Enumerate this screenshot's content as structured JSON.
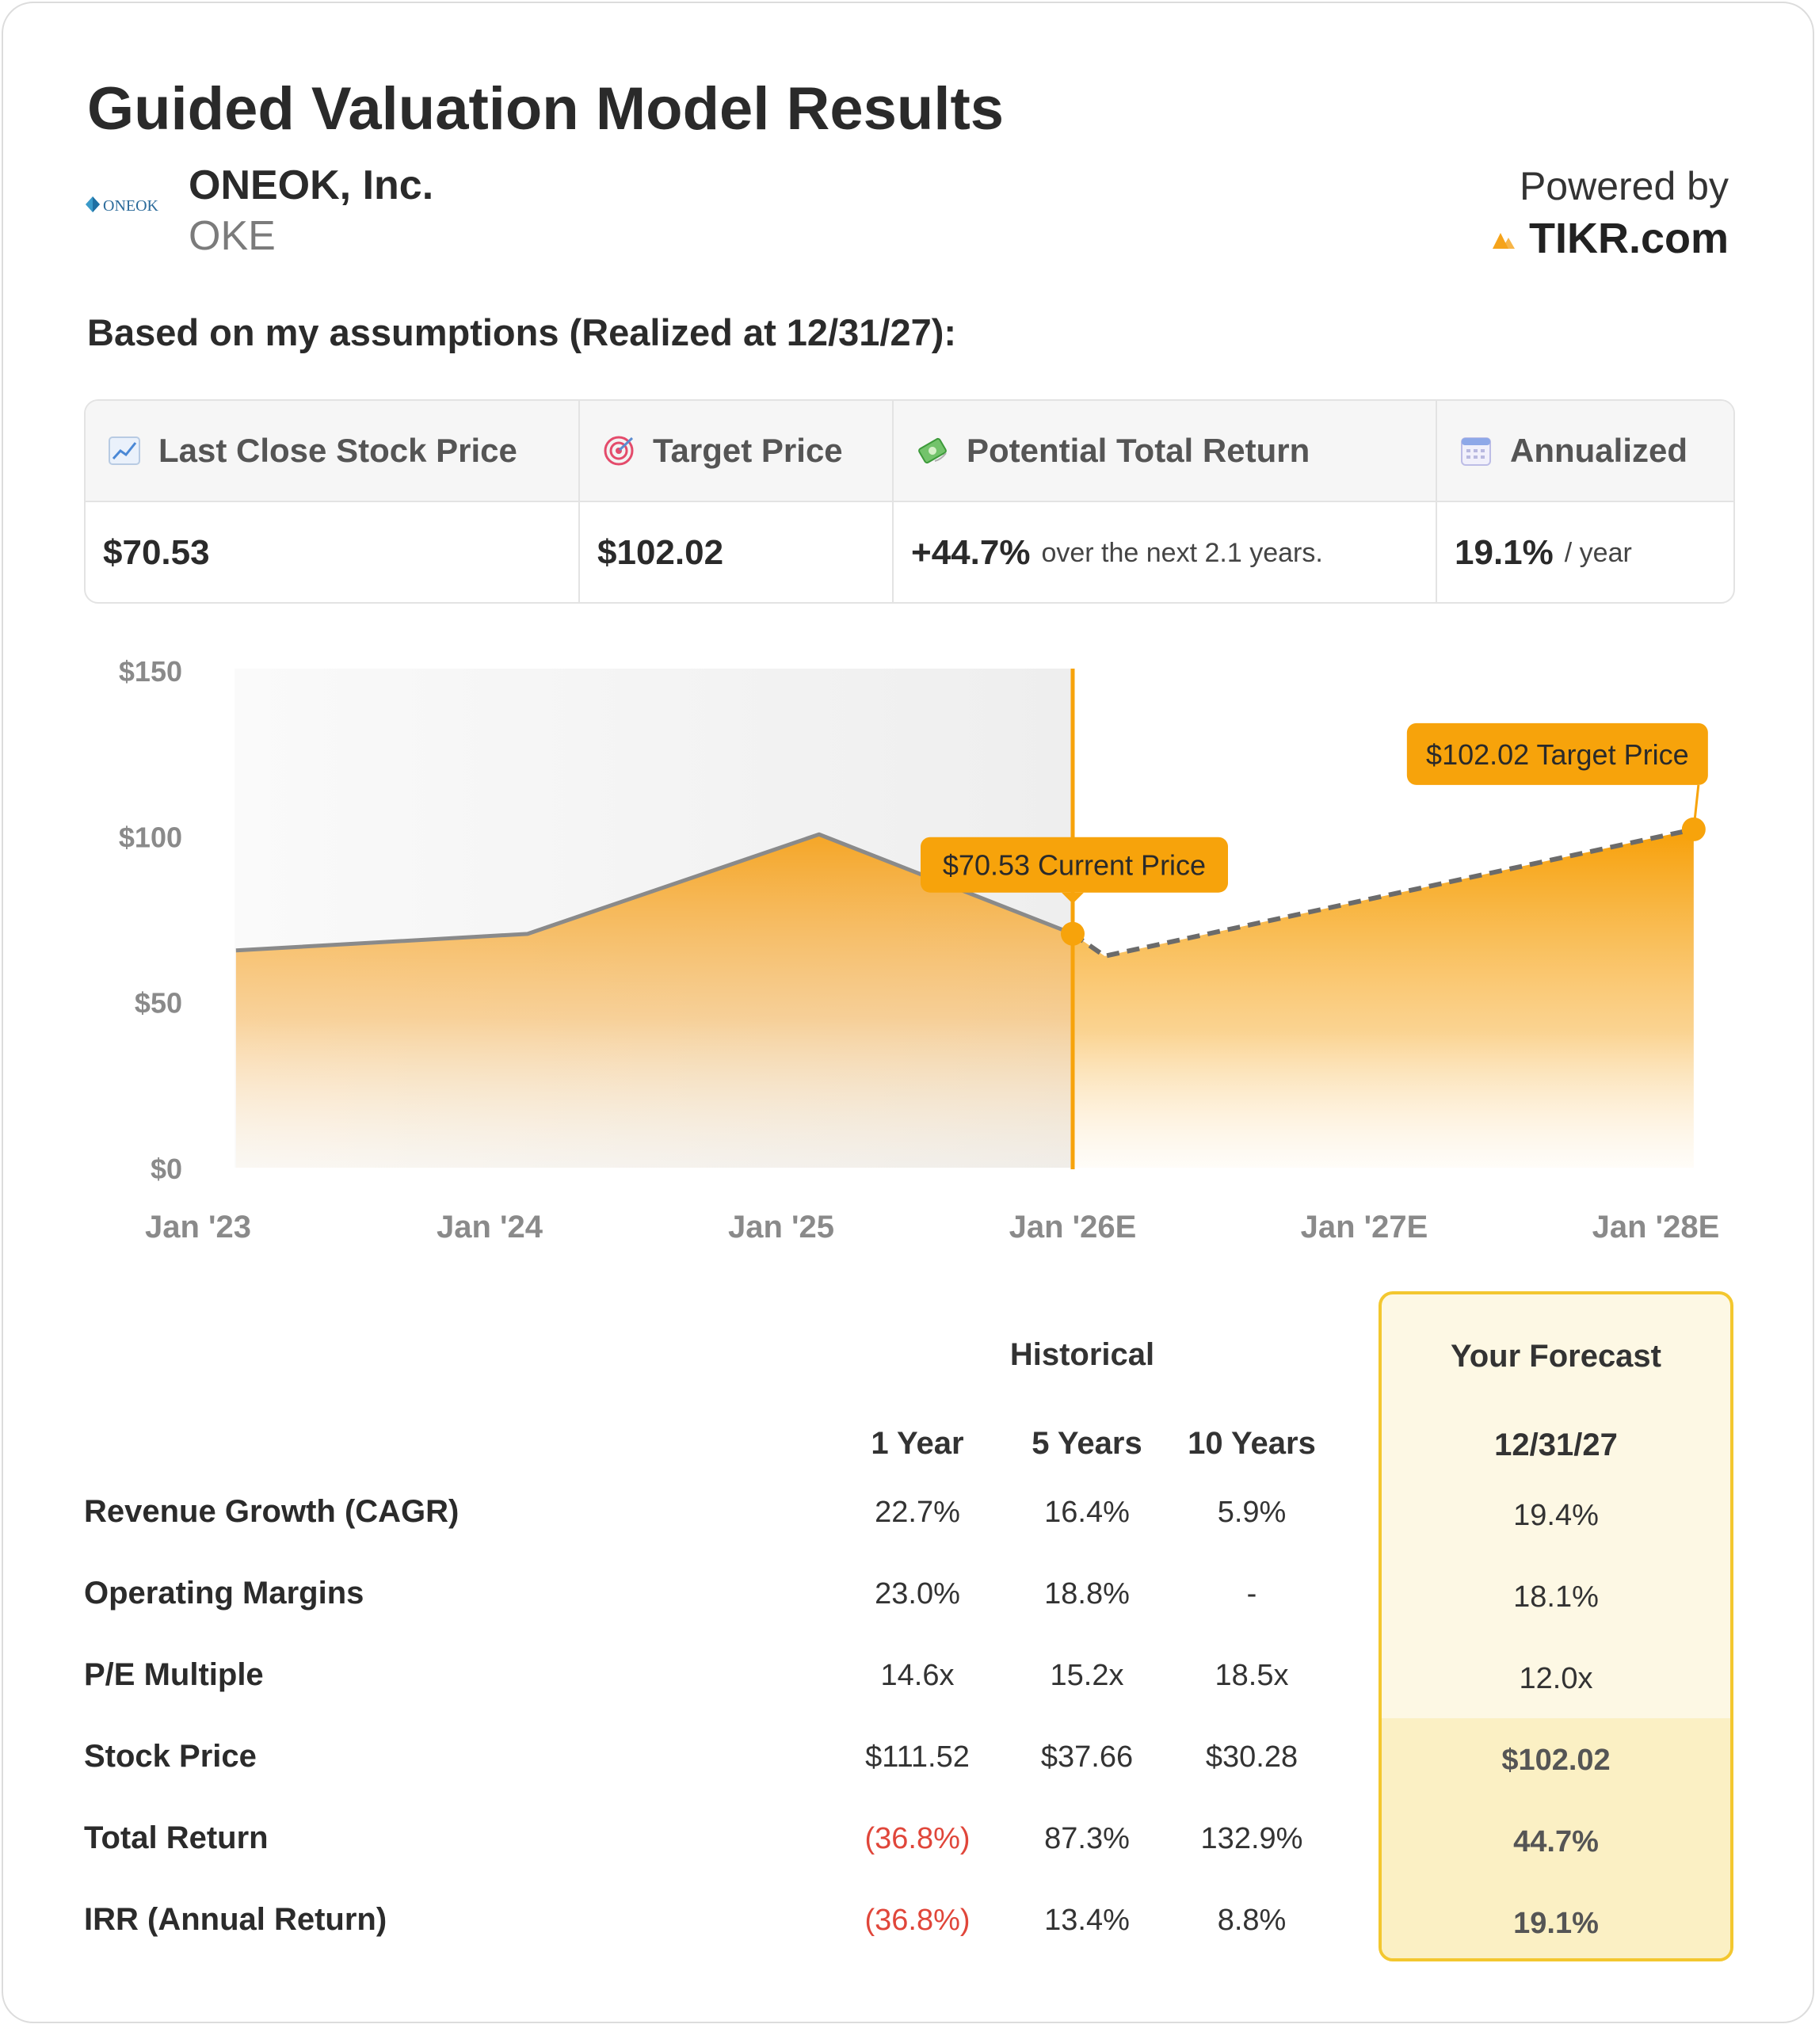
{
  "header": {
    "title": "Guided Valuation Model Results",
    "company_logo_text": "ONEOK",
    "company_name": "ONEOK, Inc.",
    "ticker": "OKE",
    "powered_by": "Powered by",
    "brand": "TIKR.com"
  },
  "subtitle": "Based on my assumptions (Realized at 12/31/27):",
  "summary": {
    "last_close": {
      "label": "Last Close Stock Price",
      "icon": "chart-increasing-icon",
      "value": "$70.53"
    },
    "target": {
      "label": "Target Price",
      "icon": "target-icon",
      "value": "$102.02"
    },
    "total_return": {
      "label": "Potential Total Return",
      "icon": "money-with-wings-icon",
      "value": "+44.7%",
      "note": "over the next 2.1 years."
    },
    "annualized": {
      "label": "Annualized",
      "icon": "calendar-icon",
      "value": "19.1%",
      "note": "/ year"
    }
  },
  "chart_data": {
    "type": "area",
    "x_ticks": [
      "Jan '23",
      "Jan '24",
      "Jan '25",
      "Jan '26E",
      "Jan '27E",
      "Jan '28E"
    ],
    "y_ticks": [
      "$0",
      "$50",
      "$100",
      "$150"
    ],
    "ylim": [
      0,
      150
    ],
    "xlim": [
      2023,
      2028
    ],
    "historical": {
      "x": [
        2023.13,
        2024.13,
        2025.13,
        2026.0
      ],
      "y": [
        65.5,
        70.5,
        100.5,
        70.53
      ]
    },
    "forecast": {
      "x": [
        2026.0,
        2026.11,
        2028.13
      ],
      "y": [
        70.53,
        63.8,
        102.02
      ]
    },
    "annotations": [
      {
        "label": "$70.53 Current Price",
        "x": 2026.0,
        "y": 70.53
      },
      {
        "label": "$102.02 Target Price",
        "x": 2028.13,
        "y": 102.02
      }
    ],
    "colors": {
      "area": "#f5a623",
      "line": "#8a8a8a",
      "accent": "#f7a30b",
      "shade": "#eeeeee"
    }
  },
  "metrics": {
    "historical_header": "Historical",
    "forecast_header": "Your Forecast",
    "forecast_date": "12/31/27",
    "columns": [
      "1 Year",
      "5 Years",
      "10 Years"
    ],
    "rows": [
      {
        "label": "Revenue Growth (CAGR)",
        "values": [
          "22.7%",
          "16.4%",
          "5.9%"
        ],
        "forecast": "19.4%"
      },
      {
        "label": "Operating Margins",
        "values": [
          "23.0%",
          "18.8%",
          "-"
        ],
        "forecast": "18.1%"
      },
      {
        "label": "P/E Multiple",
        "values": [
          "14.6x",
          "15.2x",
          "18.5x"
        ],
        "forecast": "12.0x"
      },
      {
        "label": "Stock Price",
        "values": [
          "$111.52",
          "$37.66",
          "$30.28"
        ],
        "forecast": "$102.02"
      },
      {
        "label": "Total Return",
        "values": [
          "(36.8%)",
          "87.3%",
          "132.9%"
        ],
        "forecast": "44.7%"
      },
      {
        "label": "IRR (Annual Return)",
        "values": [
          "(36.8%)",
          "13.4%",
          "8.8%"
        ],
        "forecast": "19.1%"
      }
    ]
  }
}
